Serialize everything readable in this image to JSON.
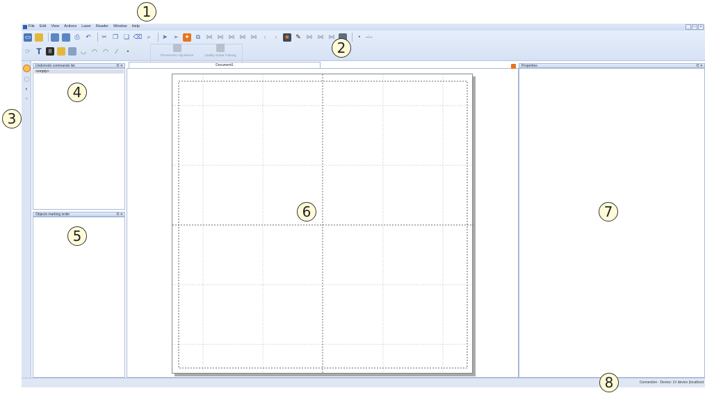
{
  "menu": [
    "File",
    "Edit",
    "View",
    "Actions",
    "Laser",
    "Reader",
    "Window",
    "Help"
  ],
  "window_controls": [
    "_",
    "□",
    "×"
  ],
  "toolbar": {
    "timer_text": "--:--",
    "group_buttons": [
      {
        "label": "Photometric Adjustment"
      },
      {
        "label": "Quality Grade Training"
      }
    ]
  },
  "panels": {
    "undo_redo": {
      "title": "Undo/redo commands list",
      "items": [
        "<empty>"
      ]
    },
    "marking_order": {
      "title": "Objects marking order"
    },
    "properties": {
      "title": "Properties"
    },
    "panel_controls": {
      "pin": "ʘ",
      "close": "✕"
    }
  },
  "document": {
    "tab": "Document1"
  },
  "status": {
    "text": "Connection · Device: LV device (localhost"
  },
  "callouts": [
    "1",
    "2",
    "3",
    "4",
    "5",
    "6",
    "7",
    "8"
  ],
  "sidebar_icons": [
    "select-icon",
    "circle-icon",
    "shield-icon",
    "zoom-icon"
  ],
  "colors": {
    "accent": "#2a5fb0",
    "chrome": "#dbe5f4",
    "orange": "#e8731e"
  }
}
